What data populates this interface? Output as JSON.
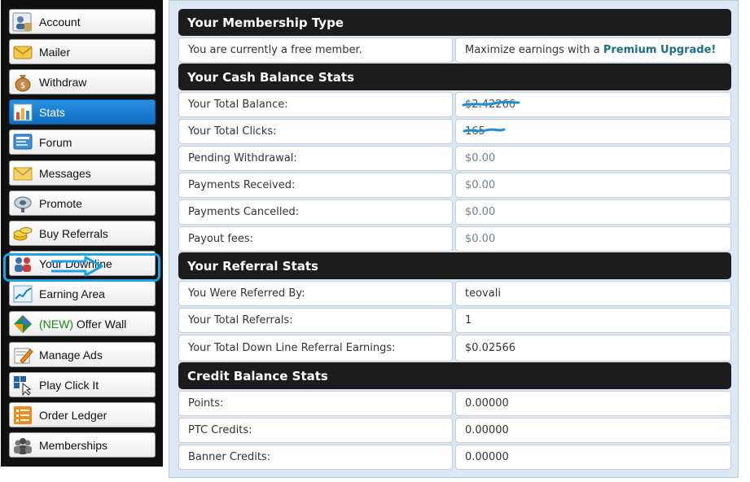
{
  "sidebar": {
    "items": [
      {
        "label": "Account",
        "icon": "account-icon"
      },
      {
        "label": "Mailer",
        "icon": "mailer-icon"
      },
      {
        "label": "Withdraw",
        "icon": "money-bag-icon"
      },
      {
        "label": "Stats",
        "icon": "bar-chart-icon",
        "active": true
      },
      {
        "label": "Forum",
        "icon": "forum-icon"
      },
      {
        "label": "Messages",
        "icon": "envelope-icon"
      },
      {
        "label": "Promote",
        "icon": "satellite-icon"
      },
      {
        "label": "Buy Referrals",
        "icon": "coins-icon"
      },
      {
        "label": "Your Downline",
        "icon": "people-icon"
      },
      {
        "label": "Earning Area",
        "icon": "line-chart-icon"
      },
      {
        "label_prefix": "(NEW)",
        "label": "Offer Wall",
        "icon": "diamond-icon"
      },
      {
        "label": "Manage Ads",
        "icon": "pencil-paper-icon"
      },
      {
        "label": "Play Click It",
        "icon": "cursor-click-icon"
      },
      {
        "label": "Order Ledger",
        "icon": "checklist-icon"
      },
      {
        "label": "Memberships",
        "icon": "group-icon"
      }
    ],
    "annotation_color": "#1aa3e8"
  },
  "membership": {
    "title": "Your Membership Type",
    "status_text": "You are currently a free member.",
    "upgrade_prefix": "Maximize earnings with a ",
    "upgrade_link": "Premium Upgrade!"
  },
  "cash": {
    "title": "Your Cash Balance Stats",
    "rows": [
      {
        "label": "Your Total Balance:",
        "value": "$2.42266"
      },
      {
        "label": "Your Total Clicks:",
        "value": "165"
      },
      {
        "label": "Pending Withdrawal:",
        "value": "$0.00"
      },
      {
        "label": "Payments Received:",
        "value": "$0.00"
      },
      {
        "label": "Payments Cancelled:",
        "value": "$0.00"
      },
      {
        "label": "Payout fees:",
        "value": "$0.00"
      }
    ]
  },
  "referral": {
    "title": "Your Referral Stats",
    "rows": [
      {
        "label": "You Were Referred By:",
        "value": "teovali"
      },
      {
        "label": "Your Total Referrals:",
        "value": "1"
      },
      {
        "label": "Your Total Down Line Referral Earnings:",
        "value": "$0.02566"
      }
    ]
  },
  "credit": {
    "title": "Credit Balance Stats",
    "rows": [
      {
        "label": "Points:",
        "value": "0.00000"
      },
      {
        "label": "PTC Credits:",
        "value": "0.00000"
      },
      {
        "label": "Banner Credits:",
        "value": "0.00000"
      }
    ]
  },
  "colors": {
    "header_bg": "#1c1c1c",
    "panel_bg": "#dbe8f3",
    "active_nav": "#1a7fd4",
    "link": "#1f6f8b",
    "muted_value": "#6e8291"
  }
}
